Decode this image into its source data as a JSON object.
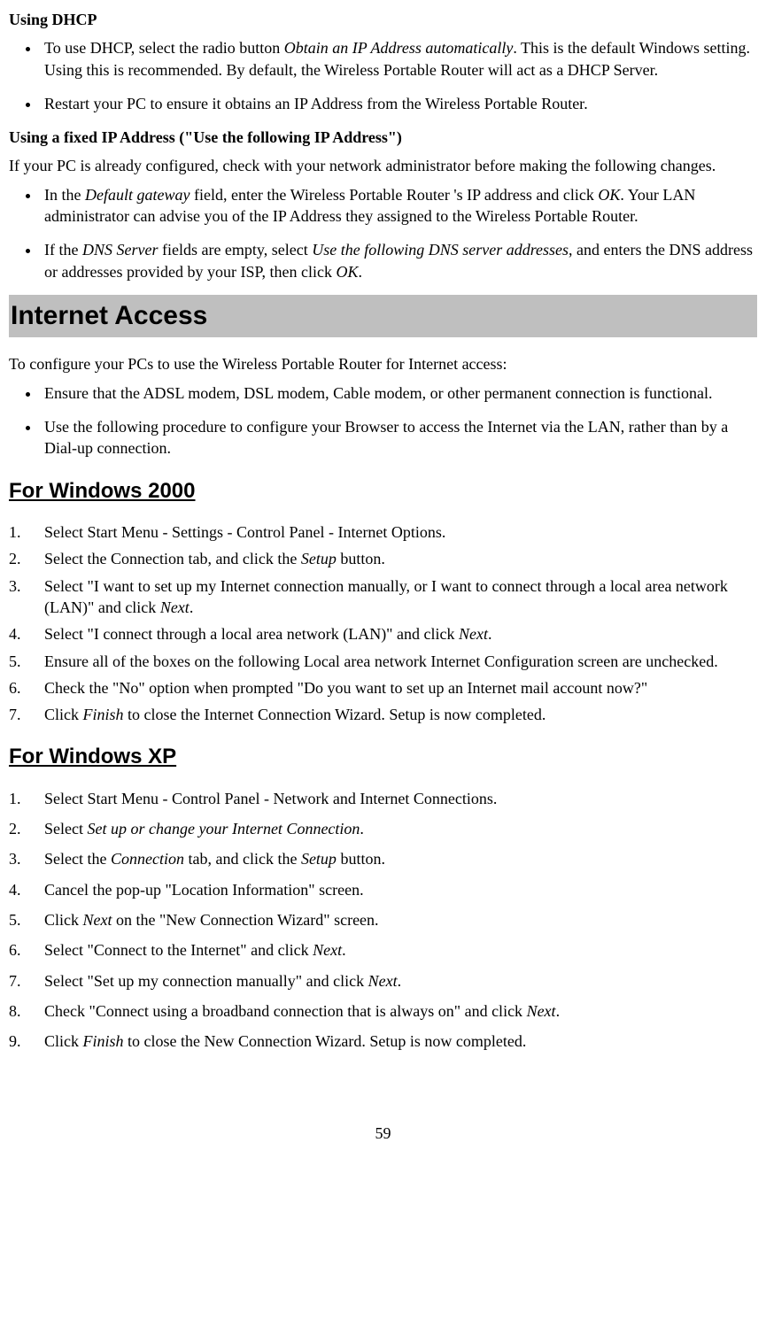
{
  "sec1": {
    "title": "Using DHCP",
    "bullets": [
      {
        "pre": "To use DHCP, select the radio button ",
        "em": "Obtain an IP Address automatically",
        "post": ". This is the default Windows setting. Using this is recommended. By default, the Wireless Portable Router will act as a DHCP Server."
      },
      {
        "pre": "Restart your PC to ensure it obtains an IP Address from the Wireless Portable Router.",
        "em": "",
        "post": ""
      }
    ]
  },
  "sec2": {
    "title": "Using a fixed IP Address (\"Use the following IP Address\")",
    "intro": "If your PC is already configured, check with your network administrator before making the following changes.",
    "bullets": [
      {
        "segments": [
          {
            "t": "In the "
          },
          {
            "t": "Default gateway",
            "em": true
          },
          {
            "t": " field, enter the Wireless Portable Router 's IP address and click "
          },
          {
            "t": "OK",
            "em": true
          },
          {
            "t": ". Your LAN administrator can advise you of the IP Address they assigned to the Wireless Portable Router."
          }
        ]
      },
      {
        "segments": [
          {
            "t": "If the "
          },
          {
            "t": "DNS Server",
            "em": true
          },
          {
            "t": " fields are empty, select "
          },
          {
            "t": "Use the following DNS server addresses",
            "em": true
          },
          {
            "t": ", and enters the DNS address or addresses provided by your ISP, then click "
          },
          {
            "t": "OK",
            "em": true
          },
          {
            "t": "."
          }
        ]
      }
    ]
  },
  "sec3": {
    "bar": "Internet Access",
    "intro": "To configure your PCs to use the Wireless Portable Router for Internet access:",
    "bullets": [
      {
        "t": "Ensure that the ADSL modem, DSL modem, Cable modem, or other permanent connection is functional."
      },
      {
        "t": "Use the following procedure to configure your Browser to access the Internet via the LAN, rather than by a Dial-up connection."
      }
    ]
  },
  "win2000": {
    "title": "For Windows 2000",
    "items": [
      {
        "segments": [
          {
            "t": "Select Start Menu - Settings - Control Panel - Internet Options."
          }
        ]
      },
      {
        "segments": [
          {
            "t": "Select the Connection tab, and click the "
          },
          {
            "t": "Setup",
            "em": true
          },
          {
            "t": " button."
          }
        ]
      },
      {
        "segments": [
          {
            "t": "Select \"I want to set up my Internet connection manually, or I want to connect through a local area network (LAN)\" and click "
          },
          {
            "t": "Next",
            "em": true
          },
          {
            "t": "."
          }
        ]
      },
      {
        "segments": [
          {
            "t": "Select \"I connect through a local area network (LAN)\" and click "
          },
          {
            "t": "Next",
            "em": true
          },
          {
            "t": "."
          }
        ]
      },
      {
        "segments": [
          {
            "t": "Ensure all of the boxes on the following Local area network Internet Configuration screen are unchecked."
          }
        ]
      },
      {
        "segments": [
          {
            "t": "Check the \"No\" option when prompted \"Do you want to set up an Internet mail account now?\""
          }
        ]
      },
      {
        "segments": [
          {
            "t": "Click "
          },
          {
            "t": "Finish",
            "em": true
          },
          {
            "t": " to close the Internet Connection Wizard. Setup is now completed."
          }
        ]
      }
    ]
  },
  "winxp": {
    "title": "For Windows XP",
    "items": [
      {
        "segments": [
          {
            "t": "Select Start Menu - Control Panel - Network and Internet Connections."
          }
        ]
      },
      {
        "segments": [
          {
            "t": "Select "
          },
          {
            "t": "Set up or change your Internet Connection",
            "em": true
          },
          {
            "t": "."
          }
        ]
      },
      {
        "segments": [
          {
            "t": "Select the "
          },
          {
            "t": "Connection",
            "em": true
          },
          {
            "t": " tab, and click the "
          },
          {
            "t": "Setup",
            "em": true
          },
          {
            "t": " button."
          }
        ]
      },
      {
        "segments": [
          {
            "t": "Cancel the pop-up \"Location Information\" screen."
          }
        ]
      },
      {
        "segments": [
          {
            "t": "Click "
          },
          {
            "t": "Next",
            "em": true
          },
          {
            "t": " on the \"New Connection Wizard\" screen."
          }
        ]
      },
      {
        "segments": [
          {
            "t": "Select \"Connect to the Internet\" and click "
          },
          {
            "t": "Next",
            "em": true
          },
          {
            "t": "."
          }
        ]
      },
      {
        "segments": [
          {
            "t": "Select \"Set up my connection manually\" and click "
          },
          {
            "t": "Next",
            "em": true
          },
          {
            "t": "."
          }
        ]
      },
      {
        "segments": [
          {
            "t": "Check \"Connect using a broadband connection that is always on\" and click "
          },
          {
            "t": "Next",
            "em": true
          },
          {
            "t": "."
          }
        ]
      },
      {
        "segments": [
          {
            "t": "Click "
          },
          {
            "t": "Finish",
            "em": true
          },
          {
            "t": " to close the New Connection Wizard. Setup is now completed."
          }
        ]
      }
    ]
  },
  "pageNumber": "59"
}
